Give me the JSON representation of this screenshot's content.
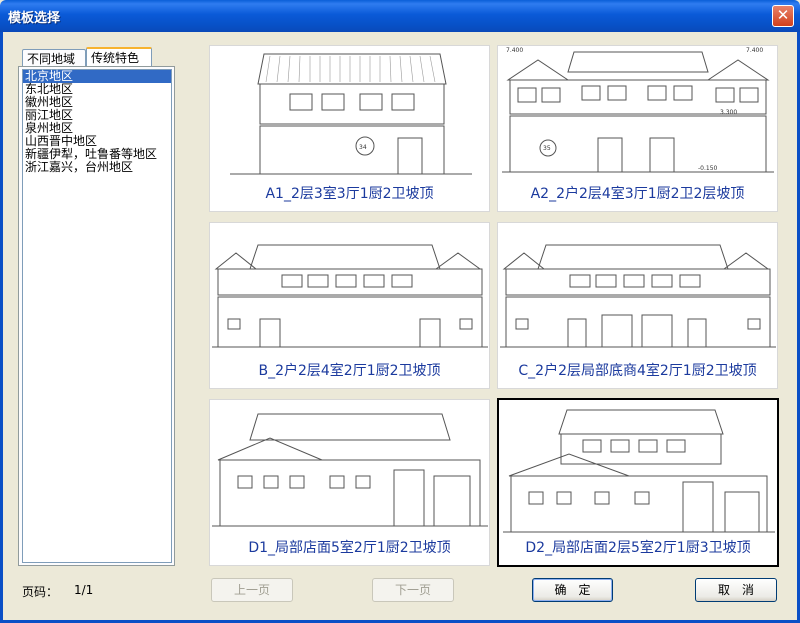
{
  "window": {
    "title": "模板选择",
    "close_glyph": "✕"
  },
  "tabs": [
    {
      "label": "不同地域",
      "active": false
    },
    {
      "label": "传统特色",
      "active": true
    }
  ],
  "regions": [
    {
      "label": "北京地区",
      "selected": true
    },
    {
      "label": "东北地区",
      "selected": false
    },
    {
      "label": "徽州地区",
      "selected": false
    },
    {
      "label": "丽江地区",
      "selected": false
    },
    {
      "label": "泉州地区",
      "selected": false
    },
    {
      "label": "山西晋中地区",
      "selected": false
    },
    {
      "label": "新疆伊犁，吐鲁番等地区",
      "selected": false
    },
    {
      "label": "浙江嘉兴，台州地区",
      "selected": false
    }
  ],
  "templates": [
    {
      "caption": "A1_2层3室3厅1厨2卫坡顶",
      "selected": false
    },
    {
      "caption": "A2_2户2层4室3厅1厨2卫2层坡顶",
      "selected": false
    },
    {
      "caption": "B_2户2层4室2厅1厨2卫坡顶",
      "selected": false
    },
    {
      "caption": "C_2户2层局部底商4室2厅1厨2卫坡顶",
      "selected": false
    },
    {
      "caption": "D1_局部店面5室2厅1厨2卫坡顶",
      "selected": false
    },
    {
      "caption": "D2_局部店面2层5室2厅1厨3卫坡顶",
      "selected": true
    }
  ],
  "drawing_labels": {
    "a1_circle": "34",
    "a2_circle": "35",
    "a2_left_elev": "7.400",
    "a2_right_elev": "7.400",
    "a2_mid_elev": "3.300",
    "a2_ground": "-0.150"
  },
  "footer": {
    "page_label": "页码：",
    "page_value": "1/1",
    "prev_label": "上一页",
    "next_label": "下一页",
    "ok_label": "确　定",
    "cancel_label": "取　消"
  }
}
